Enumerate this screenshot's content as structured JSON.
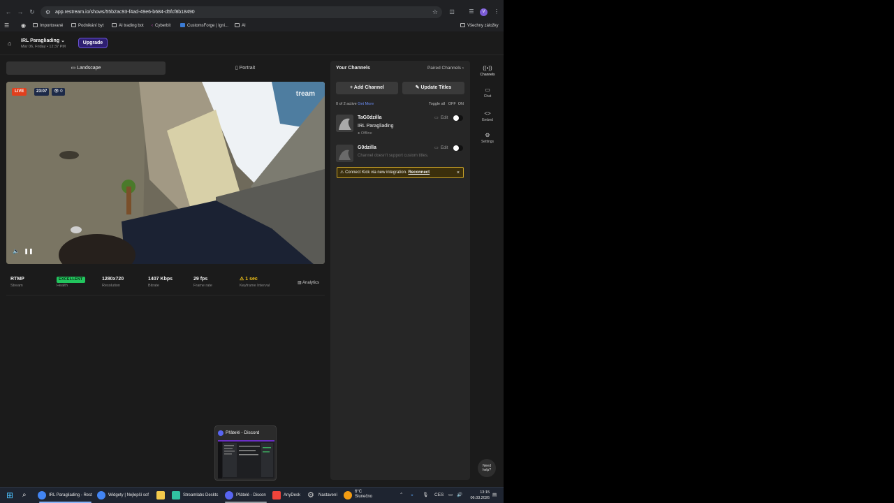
{
  "browser": {
    "url": "app.restream.io/shows/55b2ac93-f4ad-49e6-b684-d5fcf8b18490",
    "profile_initial": "V",
    "bookmarks": [
      "Importované",
      "Podnikání byt",
      "AI trading bot",
      "Cyberbit",
      "CustomsForge | Igni...",
      "AI"
    ],
    "all_bookmarks": "Všechny záložky"
  },
  "header": {
    "event_title": "IRL Paragliading",
    "event_date": "Mar 06, Friday • 12:37 PM",
    "upgrade_label": "Upgrade"
  },
  "orientation": {
    "landscape": "Landscape",
    "portrait": "Portrait"
  },
  "preview": {
    "live_label": "LIVE",
    "timer": "23:07",
    "viewers": "0",
    "watermark": "tream"
  },
  "stats": [
    {
      "value": "RTMP",
      "label": "Stream"
    },
    {
      "value": "EXCELLENT",
      "label": "Health"
    },
    {
      "value": "1280x720",
      "label": "Resolution"
    },
    {
      "value": "1407 Kbps",
      "label": "Bitrate"
    },
    {
      "value": "29 fps",
      "label": "Frame rate"
    },
    {
      "value": "1 sec",
      "label": "Keyframe Interval"
    }
  ],
  "analytics_label": "Analytics",
  "channels": {
    "title": "Your Channels",
    "paired": "Paired Channels",
    "add_label": "Add Channel",
    "update_label": "Update Titles",
    "active_text": "0 of 2 active",
    "get_more": "Get More",
    "toggle_all": "Toggle all",
    "off": "OFF",
    "on": "ON",
    "edit": "Edit",
    "items": [
      {
        "name": "TaG0dzilla",
        "title": "IRL Paragliading",
        "status": "Offline"
      },
      {
        "name": "G0dzilla",
        "note": "Channel doesn't support custom titles."
      }
    ],
    "alert_text": "Connect Kick via new integration.",
    "alert_link": "Reconnect"
  },
  "rail": [
    {
      "label": "Channels",
      "icon": "broadcast-icon"
    },
    {
      "label": "Chat",
      "icon": "chat-icon"
    },
    {
      "label": "Embed",
      "icon": "code-icon"
    },
    {
      "label": "Settings",
      "icon": "gear-icon"
    }
  ],
  "need_help": [
    "Need",
    "help?"
  ],
  "popup": {
    "title": "Přátelé - Discord"
  },
  "taskbar": {
    "apps": [
      {
        "label": "IRL Paragliading - Rest",
        "color": "#4285f4"
      },
      {
        "label": "Widgety | Nejlepší sof",
        "color": "#4285f4"
      },
      {
        "label": "Streamlabs Desktc",
        "color": "#31c3a2"
      },
      {
        "label": "Přátelé - Discon",
        "color": "#5865f2"
      },
      {
        "label": "AnyDesk",
        "color": "#ef443b"
      },
      {
        "label": "Nastavení",
        "color": "#9aa0a6"
      }
    ],
    "weather_temp": "6°C",
    "weather_desc": "Slunečno",
    "lang": "CES",
    "time": "13:15",
    "date": "06.03.2026"
  }
}
